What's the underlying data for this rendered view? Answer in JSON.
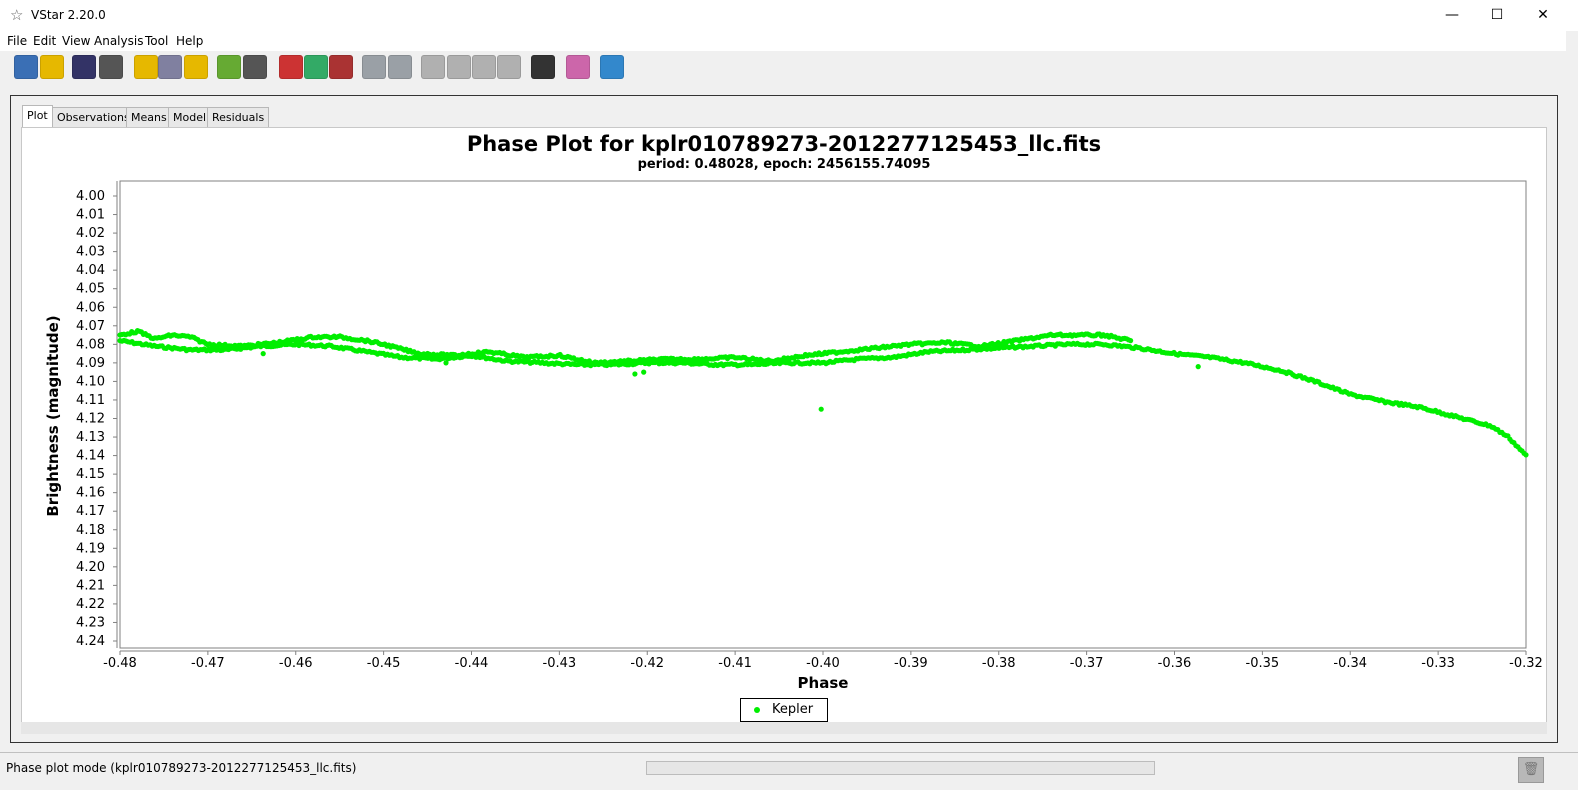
{
  "window": {
    "title": "VStar 2.20.0",
    "icon": "star-icon",
    "controls": {
      "minimize": "—",
      "maximize": "☐",
      "close": "✕"
    }
  },
  "menu": [
    "File",
    "Edit",
    "View",
    "Analysis",
    "Tool",
    "Help"
  ],
  "toolbar": [
    {
      "name": "new-star-file-button",
      "icon": "new-star-file-icon",
      "color": "#3a6fb5"
    },
    {
      "name": "open-star-button",
      "icon": "open-star-icon",
      "color": "#e6b800"
    },
    {
      "name": "save-button",
      "icon": "floppy-icon",
      "color": "#333366"
    },
    {
      "name": "print-button",
      "icon": "printer-icon",
      "color": "#555555"
    },
    {
      "name": "info-star-button",
      "icon": "star-info-icon",
      "color": "#e6b800"
    },
    {
      "name": "aavso-db-button",
      "icon": "database-icon",
      "color": "#8080a0"
    },
    {
      "name": "phase-star-button",
      "icon": "star-phase-icon",
      "color": "#e6b800"
    },
    {
      "name": "mean-plot-button",
      "icon": "bars-icon",
      "color": "#66aa33"
    },
    {
      "name": "wave-plot-button",
      "icon": "wave-icon",
      "color": "#555555"
    },
    {
      "name": "scatter-plot-button",
      "icon": "scatter-icon",
      "color": "#cc3333"
    },
    {
      "name": "period-star-button",
      "icon": "star-period-icon",
      "color": "#33aa66"
    },
    {
      "name": "model-plot-button",
      "icon": "model-icon",
      "color": "#aa3333"
    },
    {
      "name": "zoom-in-button",
      "icon": "zoom-in-icon",
      "color": "#9aa0a6"
    },
    {
      "name": "zoom-out-button",
      "icon": "zoom-out-icon",
      "color": "#9aa0a6"
    },
    {
      "name": "pan-left-button",
      "icon": "chevron-left-icon",
      "color": "#b0b0b0"
    },
    {
      "name": "pan-right-button",
      "icon": "chevron-right-icon",
      "color": "#b0b0b0"
    },
    {
      "name": "pan-up-button",
      "icon": "chevron-up-icon",
      "color": "#b0b0b0"
    },
    {
      "name": "pan-down-button",
      "icon": "chevron-down-icon",
      "color": "#b0b0b0"
    },
    {
      "name": "binoculars-button",
      "icon": "binoculars-icon",
      "color": "#333333"
    },
    {
      "name": "plugin-button",
      "icon": "plugin-icon",
      "color": "#cc66aa"
    },
    {
      "name": "help-book-button",
      "icon": "book-icon",
      "color": "#3388cc"
    }
  ],
  "tabs": [
    {
      "label": "Plot",
      "active": true
    },
    {
      "label": "Observations",
      "active": false
    },
    {
      "label": "Means",
      "active": false
    },
    {
      "label": "Model",
      "active": false
    },
    {
      "label": "Residuals",
      "active": false
    }
  ],
  "chart_data": {
    "type": "scatter",
    "title": "Phase Plot for kplr010789273-2012277125453_llc.fits",
    "subtitle": "period: 0.48028, epoch: 2456155.74095",
    "xlabel": "Phase",
    "ylabel": "Brightness (magnitude)",
    "xlim": [
      -0.48,
      -0.32
    ],
    "ylim": [
      4.24,
      4.0
    ],
    "y_inverted": true,
    "xticks": [
      "-0.48",
      "-0.47",
      "-0.46",
      "-0.45",
      "-0.44",
      "-0.43",
      "-0.42",
      "-0.41",
      "-0.40",
      "-0.39",
      "-0.38",
      "-0.37",
      "-0.36",
      "-0.35",
      "-0.34",
      "-0.33",
      "-0.32"
    ],
    "yticks": [
      "4.00",
      "4.01",
      "4.02",
      "4.03",
      "4.04",
      "4.05",
      "4.06",
      "4.07",
      "4.08",
      "4.09",
      "4.10",
      "4.11",
      "4.12",
      "4.13",
      "4.14",
      "4.15",
      "4.16",
      "4.17",
      "4.18",
      "4.19",
      "4.20",
      "4.21",
      "4.22",
      "4.23",
      "4.24"
    ],
    "grid": false,
    "legend": "bottom-center",
    "series": [
      {
        "name": "Kepler",
        "color": "#00ee00",
        "upper_track": [
          [
            -0.48,
            4.075
          ],
          [
            -0.478,
            4.073
          ],
          [
            -0.476,
            4.077
          ],
          [
            -0.474,
            4.075
          ],
          [
            -0.472,
            4.076
          ],
          [
            -0.47,
            4.08
          ],
          [
            -0.466,
            4.081
          ],
          [
            -0.462,
            4.079
          ],
          [
            -0.458,
            4.076
          ],
          [
            -0.455,
            4.076
          ],
          [
            -0.452,
            4.078
          ],
          [
            -0.45,
            4.08
          ],
          [
            -0.446,
            4.085
          ],
          [
            -0.442,
            4.086
          ],
          [
            -0.438,
            4.084
          ],
          [
            -0.434,
            4.087
          ],
          [
            -0.43,
            4.086
          ],
          [
            -0.426,
            4.09
          ],
          [
            -0.422,
            4.089
          ],
          [
            -0.418,
            4.088
          ],
          [
            -0.414,
            4.088
          ],
          [
            -0.41,
            4.087
          ],
          [
            -0.406,
            4.089
          ],
          [
            -0.402,
            4.086
          ],
          [
            -0.398,
            4.084
          ],
          [
            -0.394,
            4.082
          ],
          [
            -0.39,
            4.08
          ],
          [
            -0.386,
            4.079
          ],
          [
            -0.382,
            4.081
          ],
          [
            -0.378,
            4.078
          ],
          [
            -0.374,
            4.075
          ],
          [
            -0.371,
            4.075
          ],
          [
            -0.368,
            4.075
          ],
          [
            -0.365,
            4.078
          ]
        ],
        "lower_track": [
          [
            -0.48,
            4.078
          ],
          [
            -0.476,
            4.081
          ],
          [
            -0.472,
            4.083
          ],
          [
            -0.468,
            4.083
          ],
          [
            -0.464,
            4.081
          ],
          [
            -0.46,
            4.08
          ],
          [
            -0.456,
            4.081
          ],
          [
            -0.452,
            4.084
          ],
          [
            -0.448,
            4.087
          ],
          [
            -0.444,
            4.088
          ],
          [
            -0.44,
            4.086
          ],
          [
            -0.436,
            4.089
          ],
          [
            -0.432,
            4.09
          ],
          [
            -0.428,
            4.091
          ],
          [
            -0.424,
            4.091
          ],
          [
            -0.42,
            4.09
          ],
          [
            -0.416,
            4.09
          ],
          [
            -0.412,
            4.091
          ],
          [
            -0.408,
            4.091
          ],
          [
            -0.404,
            4.09
          ],
          [
            -0.4,
            4.09
          ],
          [
            -0.396,
            4.088
          ],
          [
            -0.392,
            4.087
          ],
          [
            -0.388,
            4.084
          ],
          [
            -0.384,
            4.083
          ],
          [
            -0.38,
            4.082
          ],
          [
            -0.376,
            4.081
          ],
          [
            -0.372,
            4.08
          ],
          [
            -0.368,
            4.08
          ],
          [
            -0.364,
            4.082
          ],
          [
            -0.36,
            4.085
          ],
          [
            -0.356,
            4.087
          ],
          [
            -0.352,
            4.09
          ],
          [
            -0.348,
            4.094
          ],
          [
            -0.344,
            4.1
          ],
          [
            -0.34,
            4.107
          ],
          [
            -0.336,
            4.111
          ],
          [
            -0.332,
            4.114
          ],
          [
            -0.328,
            4.119
          ],
          [
            -0.324,
            4.124
          ],
          [
            -0.322,
            4.13
          ],
          [
            -0.32,
            4.14
          ]
        ],
        "outliers": [
          [
            -0.4637,
            4.085
          ],
          [
            -0.4429,
            4.09
          ],
          [
            -0.4214,
            4.096
          ],
          [
            -0.4204,
            4.095
          ],
          [
            -0.4002,
            4.115
          ],
          [
            -0.3573,
            4.092
          ]
        ]
      }
    ]
  },
  "status": {
    "text": "Phase plot mode (kplr010789273-2012277125453_llc.fits)",
    "progress": 0,
    "trash_icon": "trash-icon"
  }
}
